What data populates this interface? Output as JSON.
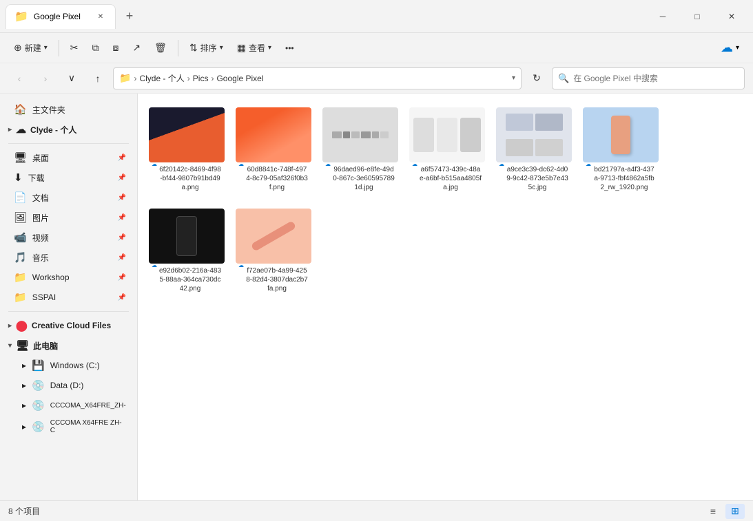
{
  "titlebar": {
    "tab_icon": "📁",
    "tab_label": "Google Pixel",
    "new_tab_label": "+",
    "close_label": "✕",
    "minimize_label": "─",
    "maximize_label": "□",
    "winclose_label": "✕"
  },
  "toolbar": {
    "new_label": "新建",
    "cut_label": "✂",
    "copy_label": "⧉",
    "paste_label": "⧇",
    "share_label": "↗",
    "delete_label": "🗑",
    "sort_label": "排序",
    "view_label": "查看",
    "more_label": "•••",
    "cloud_label": "☁"
  },
  "addressbar": {
    "back_label": "‹",
    "forward_label": "›",
    "up_list_label": "∨",
    "up_label": "↑",
    "folder_icon": "📁",
    "breadcrumbs": [
      "Clyde - 个人",
      "Pics",
      "Google Pixel"
    ],
    "refresh_label": "↻",
    "search_placeholder": "在 Google Pixel 中搜索",
    "search_icon": "🔍"
  },
  "sidebar": {
    "home_label": "主文件夹",
    "clyde_label": "Clyde - 个人",
    "desktop_label": "桌面",
    "downloads_label": "下载",
    "documents_label": "文档",
    "pictures_label": "图片",
    "videos_label": "视频",
    "music_label": "音乐",
    "workshop_label": "Workshop",
    "sspai_label": "SSPAI",
    "creative_cloud_label": "Creative Cloud Files",
    "this_pc_label": "此电脑",
    "windows_c_label": "Windows (C:)",
    "data_d_label": "Data (D:)",
    "cccoma1_label": "CCCOMA_X64FRE_ZH-",
    "cccoma2_label": "CCCOMA X64FRE ZH-C"
  },
  "files": [
    {
      "name": "6f20142c-8469-4f98-bf44-9807b91bd49a.png",
      "cloud": true,
      "thumb_class": "thumb-1"
    },
    {
      "name": "60d8841c-748f-4974-8c79-05af326f0b3f.png",
      "cloud": true,
      "thumb_class": "thumb-2"
    },
    {
      "name": "96daed96-e8fe-49d0-867c-3e605957891d.jpg",
      "cloud": true,
      "thumb_class": "thumb-3"
    },
    {
      "name": "a6f57473-439c-48ae-a6bf-b515aa4805fa.jpg",
      "cloud": true,
      "thumb_class": "thumb-4"
    },
    {
      "name": "a9ce3c39-dc62-4d09-9c42-873e5b7e435c.jpg",
      "cloud": true,
      "thumb_class": "thumb-5"
    },
    {
      "name": "bd21797a-a4f3-437a-9713-fbf4862a5fb2_rw_1920.png",
      "cloud": true,
      "thumb_class": "thumb-6"
    },
    {
      "name": "e92d6b02-216a-4835-88aa-364ca730dc42.png",
      "cloud": true,
      "thumb_class": "thumb-7"
    },
    {
      "name": "f72ae07b-4a99-4258-82d4-3807dac2b7fa.png",
      "cloud": true,
      "thumb_class": "thumb-8"
    }
  ],
  "statusbar": {
    "count_label": "8 个项目",
    "list_view_icon": "≡",
    "grid_view_icon": "⊞"
  }
}
